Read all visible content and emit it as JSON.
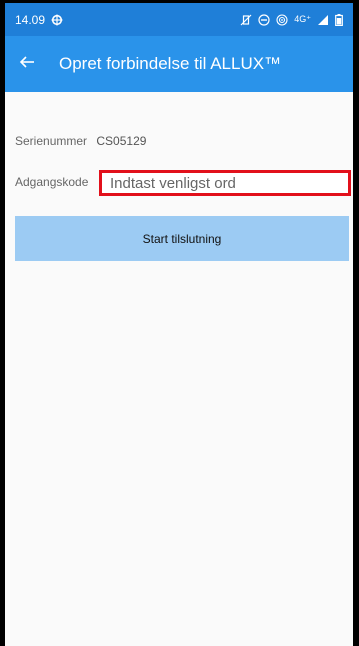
{
  "status_bar": {
    "time": "14.09",
    "network": "4G⁺"
  },
  "app_bar": {
    "title": "Opret forbindelse til ALLUX™"
  },
  "form": {
    "serial_label": "Serienummer",
    "serial_value": "CS05129",
    "password_label": "Adgangskode",
    "password_placeholder": "Indtast venligst ord",
    "password_value": ""
  },
  "actions": {
    "start_label": "Start tilslutning"
  },
  "colors": {
    "status_bar": "#1f7fd8",
    "app_bar": "#2a93ea",
    "button": "#9ccbf3",
    "highlight": "#e2101b"
  },
  "icons": {
    "status_left": [
      "settings-gear-icon"
    ],
    "status_right": [
      "vibrate-off-icon",
      "do-not-disturb-icon",
      "hotspot-icon",
      "signal-icon",
      "battery-icon"
    ],
    "app_bar": [
      "back-arrow-icon"
    ]
  }
}
